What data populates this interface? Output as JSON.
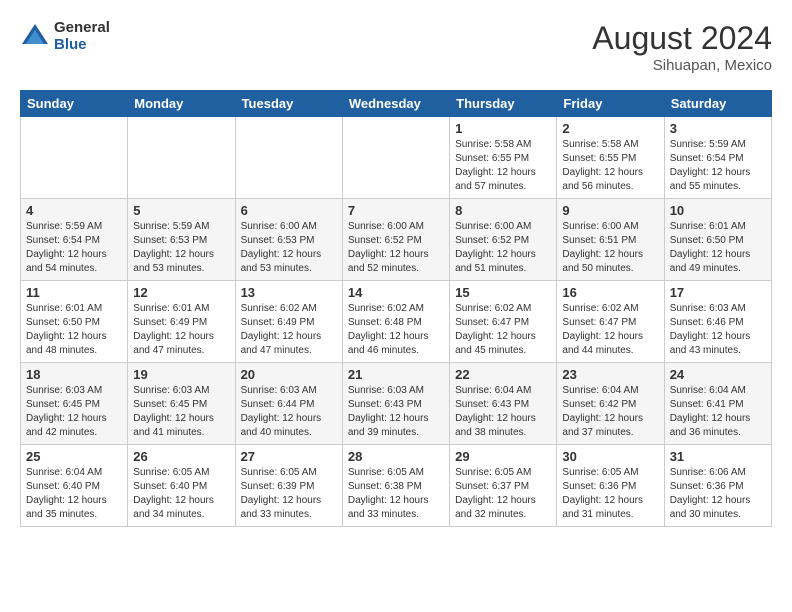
{
  "header": {
    "logo_general": "General",
    "logo_blue": "Blue",
    "month_year": "August 2024",
    "location": "Sihuapan, Mexico"
  },
  "days_of_week": [
    "Sunday",
    "Monday",
    "Tuesday",
    "Wednesday",
    "Thursday",
    "Friday",
    "Saturday"
  ],
  "weeks": [
    [
      {
        "day": "",
        "info": ""
      },
      {
        "day": "",
        "info": ""
      },
      {
        "day": "",
        "info": ""
      },
      {
        "day": "",
        "info": ""
      },
      {
        "day": "1",
        "info": "Sunrise: 5:58 AM\nSunset: 6:55 PM\nDaylight: 12 hours\nand 57 minutes."
      },
      {
        "day": "2",
        "info": "Sunrise: 5:58 AM\nSunset: 6:55 PM\nDaylight: 12 hours\nand 56 minutes."
      },
      {
        "day": "3",
        "info": "Sunrise: 5:59 AM\nSunset: 6:54 PM\nDaylight: 12 hours\nand 55 minutes."
      }
    ],
    [
      {
        "day": "4",
        "info": "Sunrise: 5:59 AM\nSunset: 6:54 PM\nDaylight: 12 hours\nand 54 minutes."
      },
      {
        "day": "5",
        "info": "Sunrise: 5:59 AM\nSunset: 6:53 PM\nDaylight: 12 hours\nand 53 minutes."
      },
      {
        "day": "6",
        "info": "Sunrise: 6:00 AM\nSunset: 6:53 PM\nDaylight: 12 hours\nand 53 minutes."
      },
      {
        "day": "7",
        "info": "Sunrise: 6:00 AM\nSunset: 6:52 PM\nDaylight: 12 hours\nand 52 minutes."
      },
      {
        "day": "8",
        "info": "Sunrise: 6:00 AM\nSunset: 6:52 PM\nDaylight: 12 hours\nand 51 minutes."
      },
      {
        "day": "9",
        "info": "Sunrise: 6:00 AM\nSunset: 6:51 PM\nDaylight: 12 hours\nand 50 minutes."
      },
      {
        "day": "10",
        "info": "Sunrise: 6:01 AM\nSunset: 6:50 PM\nDaylight: 12 hours\nand 49 minutes."
      }
    ],
    [
      {
        "day": "11",
        "info": "Sunrise: 6:01 AM\nSunset: 6:50 PM\nDaylight: 12 hours\nand 48 minutes."
      },
      {
        "day": "12",
        "info": "Sunrise: 6:01 AM\nSunset: 6:49 PM\nDaylight: 12 hours\nand 47 minutes."
      },
      {
        "day": "13",
        "info": "Sunrise: 6:02 AM\nSunset: 6:49 PM\nDaylight: 12 hours\nand 47 minutes."
      },
      {
        "day": "14",
        "info": "Sunrise: 6:02 AM\nSunset: 6:48 PM\nDaylight: 12 hours\nand 46 minutes."
      },
      {
        "day": "15",
        "info": "Sunrise: 6:02 AM\nSunset: 6:47 PM\nDaylight: 12 hours\nand 45 minutes."
      },
      {
        "day": "16",
        "info": "Sunrise: 6:02 AM\nSunset: 6:47 PM\nDaylight: 12 hours\nand 44 minutes."
      },
      {
        "day": "17",
        "info": "Sunrise: 6:03 AM\nSunset: 6:46 PM\nDaylight: 12 hours\nand 43 minutes."
      }
    ],
    [
      {
        "day": "18",
        "info": "Sunrise: 6:03 AM\nSunset: 6:45 PM\nDaylight: 12 hours\nand 42 minutes."
      },
      {
        "day": "19",
        "info": "Sunrise: 6:03 AM\nSunset: 6:45 PM\nDaylight: 12 hours\nand 41 minutes."
      },
      {
        "day": "20",
        "info": "Sunrise: 6:03 AM\nSunset: 6:44 PM\nDaylight: 12 hours\nand 40 minutes."
      },
      {
        "day": "21",
        "info": "Sunrise: 6:03 AM\nSunset: 6:43 PM\nDaylight: 12 hours\nand 39 minutes."
      },
      {
        "day": "22",
        "info": "Sunrise: 6:04 AM\nSunset: 6:43 PM\nDaylight: 12 hours\nand 38 minutes."
      },
      {
        "day": "23",
        "info": "Sunrise: 6:04 AM\nSunset: 6:42 PM\nDaylight: 12 hours\nand 37 minutes."
      },
      {
        "day": "24",
        "info": "Sunrise: 6:04 AM\nSunset: 6:41 PM\nDaylight: 12 hours\nand 36 minutes."
      }
    ],
    [
      {
        "day": "25",
        "info": "Sunrise: 6:04 AM\nSunset: 6:40 PM\nDaylight: 12 hours\nand 35 minutes."
      },
      {
        "day": "26",
        "info": "Sunrise: 6:05 AM\nSunset: 6:40 PM\nDaylight: 12 hours\nand 34 minutes."
      },
      {
        "day": "27",
        "info": "Sunrise: 6:05 AM\nSunset: 6:39 PM\nDaylight: 12 hours\nand 33 minutes."
      },
      {
        "day": "28",
        "info": "Sunrise: 6:05 AM\nSunset: 6:38 PM\nDaylight: 12 hours\nand 33 minutes."
      },
      {
        "day": "29",
        "info": "Sunrise: 6:05 AM\nSunset: 6:37 PM\nDaylight: 12 hours\nand 32 minutes."
      },
      {
        "day": "30",
        "info": "Sunrise: 6:05 AM\nSunset: 6:36 PM\nDaylight: 12 hours\nand 31 minutes."
      },
      {
        "day": "31",
        "info": "Sunrise: 6:06 AM\nSunset: 6:36 PM\nDaylight: 12 hours\nand 30 minutes."
      }
    ]
  ]
}
